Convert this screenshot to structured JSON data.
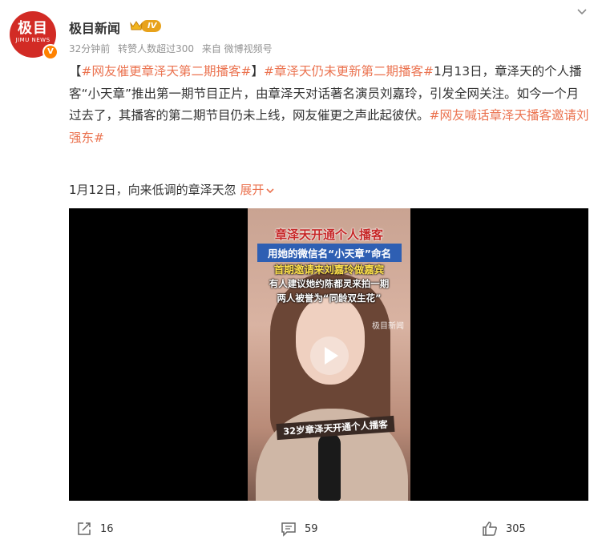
{
  "account": {
    "avatar_text": "极目",
    "avatar_sub": "JIMU NEWS",
    "verified_mark": "V",
    "name": "极目新闻",
    "level": "IV"
  },
  "meta": {
    "time": "32分钟前",
    "reposts_note": "转赞人数超过300",
    "source": "来自 微博视频号"
  },
  "post": {
    "bracket_open": "【",
    "tag1": "#网友催更章泽天第二期播客#",
    "bracket_close": "】",
    "tag2": "#章泽天仍未更新第二期播客#",
    "body": "1月13日，章泽天的个人播客“小天章”推出第一期节目正片，由章泽天对话著名演员刘嘉玲，引发全网关注。如今一个月过去了，其播客的第二期节目仍未上线，网友催更之声此起彼伏。",
    "tag3": "#网友喊话章泽天播客邀请刘强东#",
    "second_line": "1月12日，向来低调的章泽天忽",
    "expand": "展开"
  },
  "video": {
    "overlay_title": "章泽天开通个人播客",
    "overlay_line2": "用她的微信名“小天章”命名",
    "overlay_line3": "首期邀请来刘嘉玲做嘉宾",
    "overlay_line4": "有人建议她约陈都灵来拍一期",
    "overlay_line5": "两人被誉为“同龄双生花”",
    "watermark": "极目新闻",
    "caption": "32岁章泽天开通个人播客"
  },
  "actions": {
    "repost_count": "16",
    "comment_count": "59",
    "like_count": "305"
  },
  "colors": {
    "accent": "#eb7350",
    "brand_red": "#d22b25",
    "level_gold": "#e8a21b",
    "verify_orange": "#ff8200"
  },
  "icons": [
    "chevron-down-icon",
    "crown-icon",
    "play-icon",
    "repost-icon",
    "comment-icon",
    "like-icon"
  ]
}
